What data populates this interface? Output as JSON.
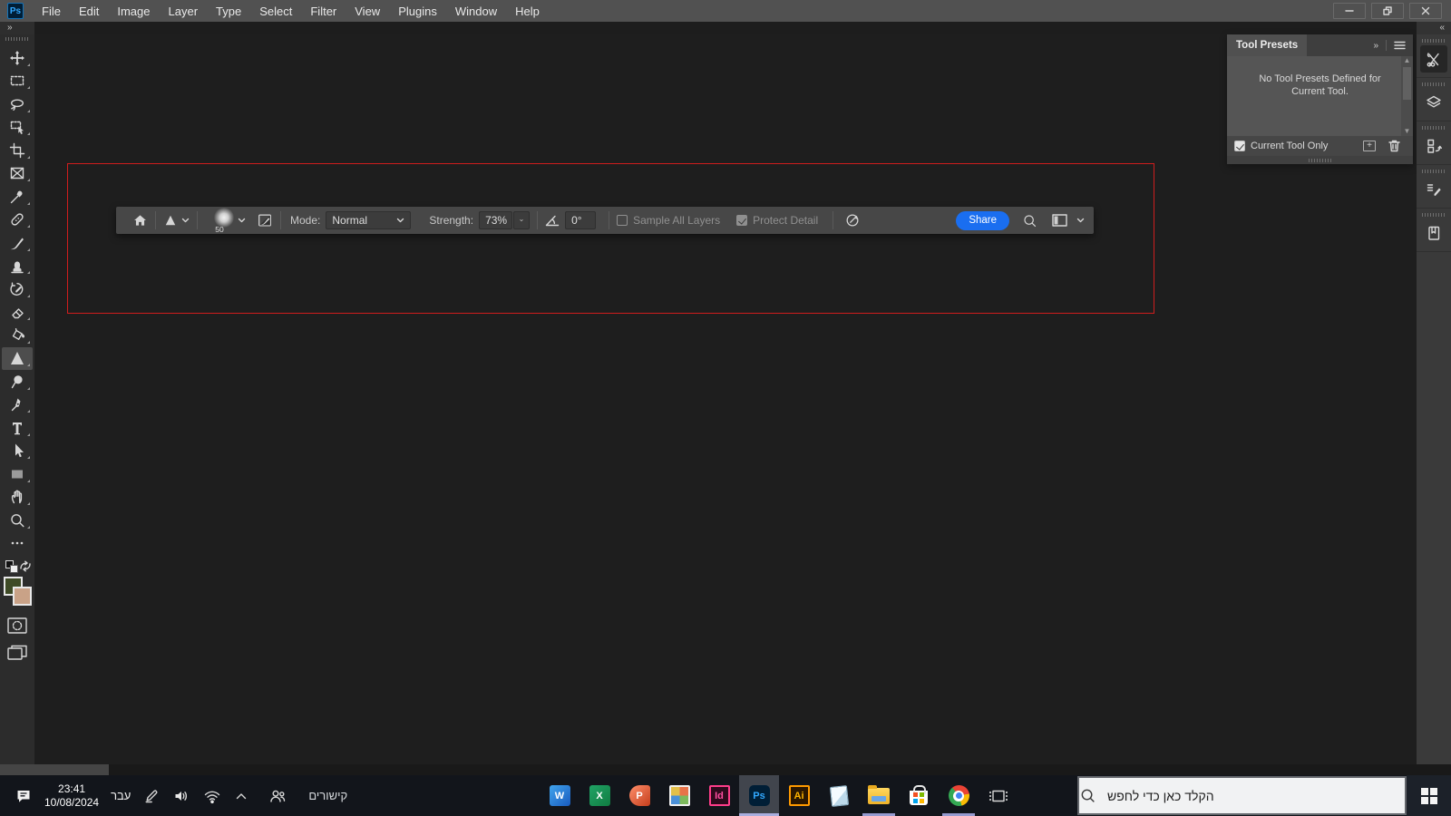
{
  "app": {
    "logo_glyph": "Ps"
  },
  "menu_bar": {
    "items": [
      "File",
      "Edit",
      "Image",
      "Layer",
      "Type",
      "Select",
      "Filter",
      "View",
      "Plugins",
      "Window",
      "Help"
    ],
    "window_controls": [
      "minimize",
      "restore",
      "close"
    ]
  },
  "toolbar": {
    "expand_glyph": "»",
    "tools": [
      "move",
      "rectangular-marquee",
      "lasso",
      "object-selection",
      "crop",
      "frame",
      "eyedropper",
      "spot-healing-brush",
      "brush",
      "clone-stamp",
      "history-brush",
      "eraser",
      "gradient-fill",
      "sharpen",
      "dodge",
      "pen",
      "type",
      "path-selection",
      "rectangle-shape",
      "hand",
      "zoom",
      "edit-toolbar-more"
    ],
    "selected_tool": "sharpen",
    "foreground_color": "#3e4a25",
    "background_color": "#c9a287"
  },
  "options_bar": {
    "brush_size": "50",
    "mode_label": "Mode:",
    "mode_value": "Normal",
    "strength_label": "Strength:",
    "strength_value": "73%",
    "angle_value": "0°",
    "sample_all_layers_label": "Sample All Layers",
    "sample_all_layers_checked": false,
    "protect_detail_label": "Protect Detail",
    "protect_detail_checked": true,
    "share_label": "Share"
  },
  "tool_presets_panel": {
    "title": "Tool Presets",
    "collapse_glyph": "»",
    "empty_message": "No Tool Presets Defined for Current Tool.",
    "current_tool_only_label": "Current Tool Only",
    "current_tool_only_checked": true
  },
  "right_dock": {
    "collapse_glyph": "«",
    "icons": [
      "tool-presets",
      "layers",
      "clone-source",
      "brush-settings",
      "libraries"
    ]
  },
  "taskbar": {
    "clock": {
      "time": "23:41",
      "date": "10/08/2024"
    },
    "language_indicator": "עבר",
    "links_label": "קישורים",
    "search_placeholder": "הקלד כאן כדי לחפש",
    "pinned_apps": [
      {
        "name": "word",
        "glyph": "W"
      },
      {
        "name": "excel",
        "glyph": "X"
      },
      {
        "name": "powerpoint",
        "glyph": "P"
      },
      {
        "name": "photos",
        "glyph": ""
      },
      {
        "name": "indesign",
        "glyph": "Id"
      },
      {
        "name": "photoshop",
        "glyph": "Ps",
        "active": true
      },
      {
        "name": "illustrator",
        "glyph": "Ai"
      },
      {
        "name": "notepad",
        "glyph": ""
      },
      {
        "name": "file-explorer",
        "glyph": ""
      },
      {
        "name": "microsoft-store",
        "glyph": ""
      },
      {
        "name": "chrome",
        "glyph": ""
      }
    ]
  },
  "colors": {
    "share_button": "#1a6ef0",
    "annotation_red": "#cf1d1d",
    "taskbar_underline": "#969bd0",
    "foreground_swatch": "#3e4a25",
    "background_swatch": "#c9a287"
  }
}
